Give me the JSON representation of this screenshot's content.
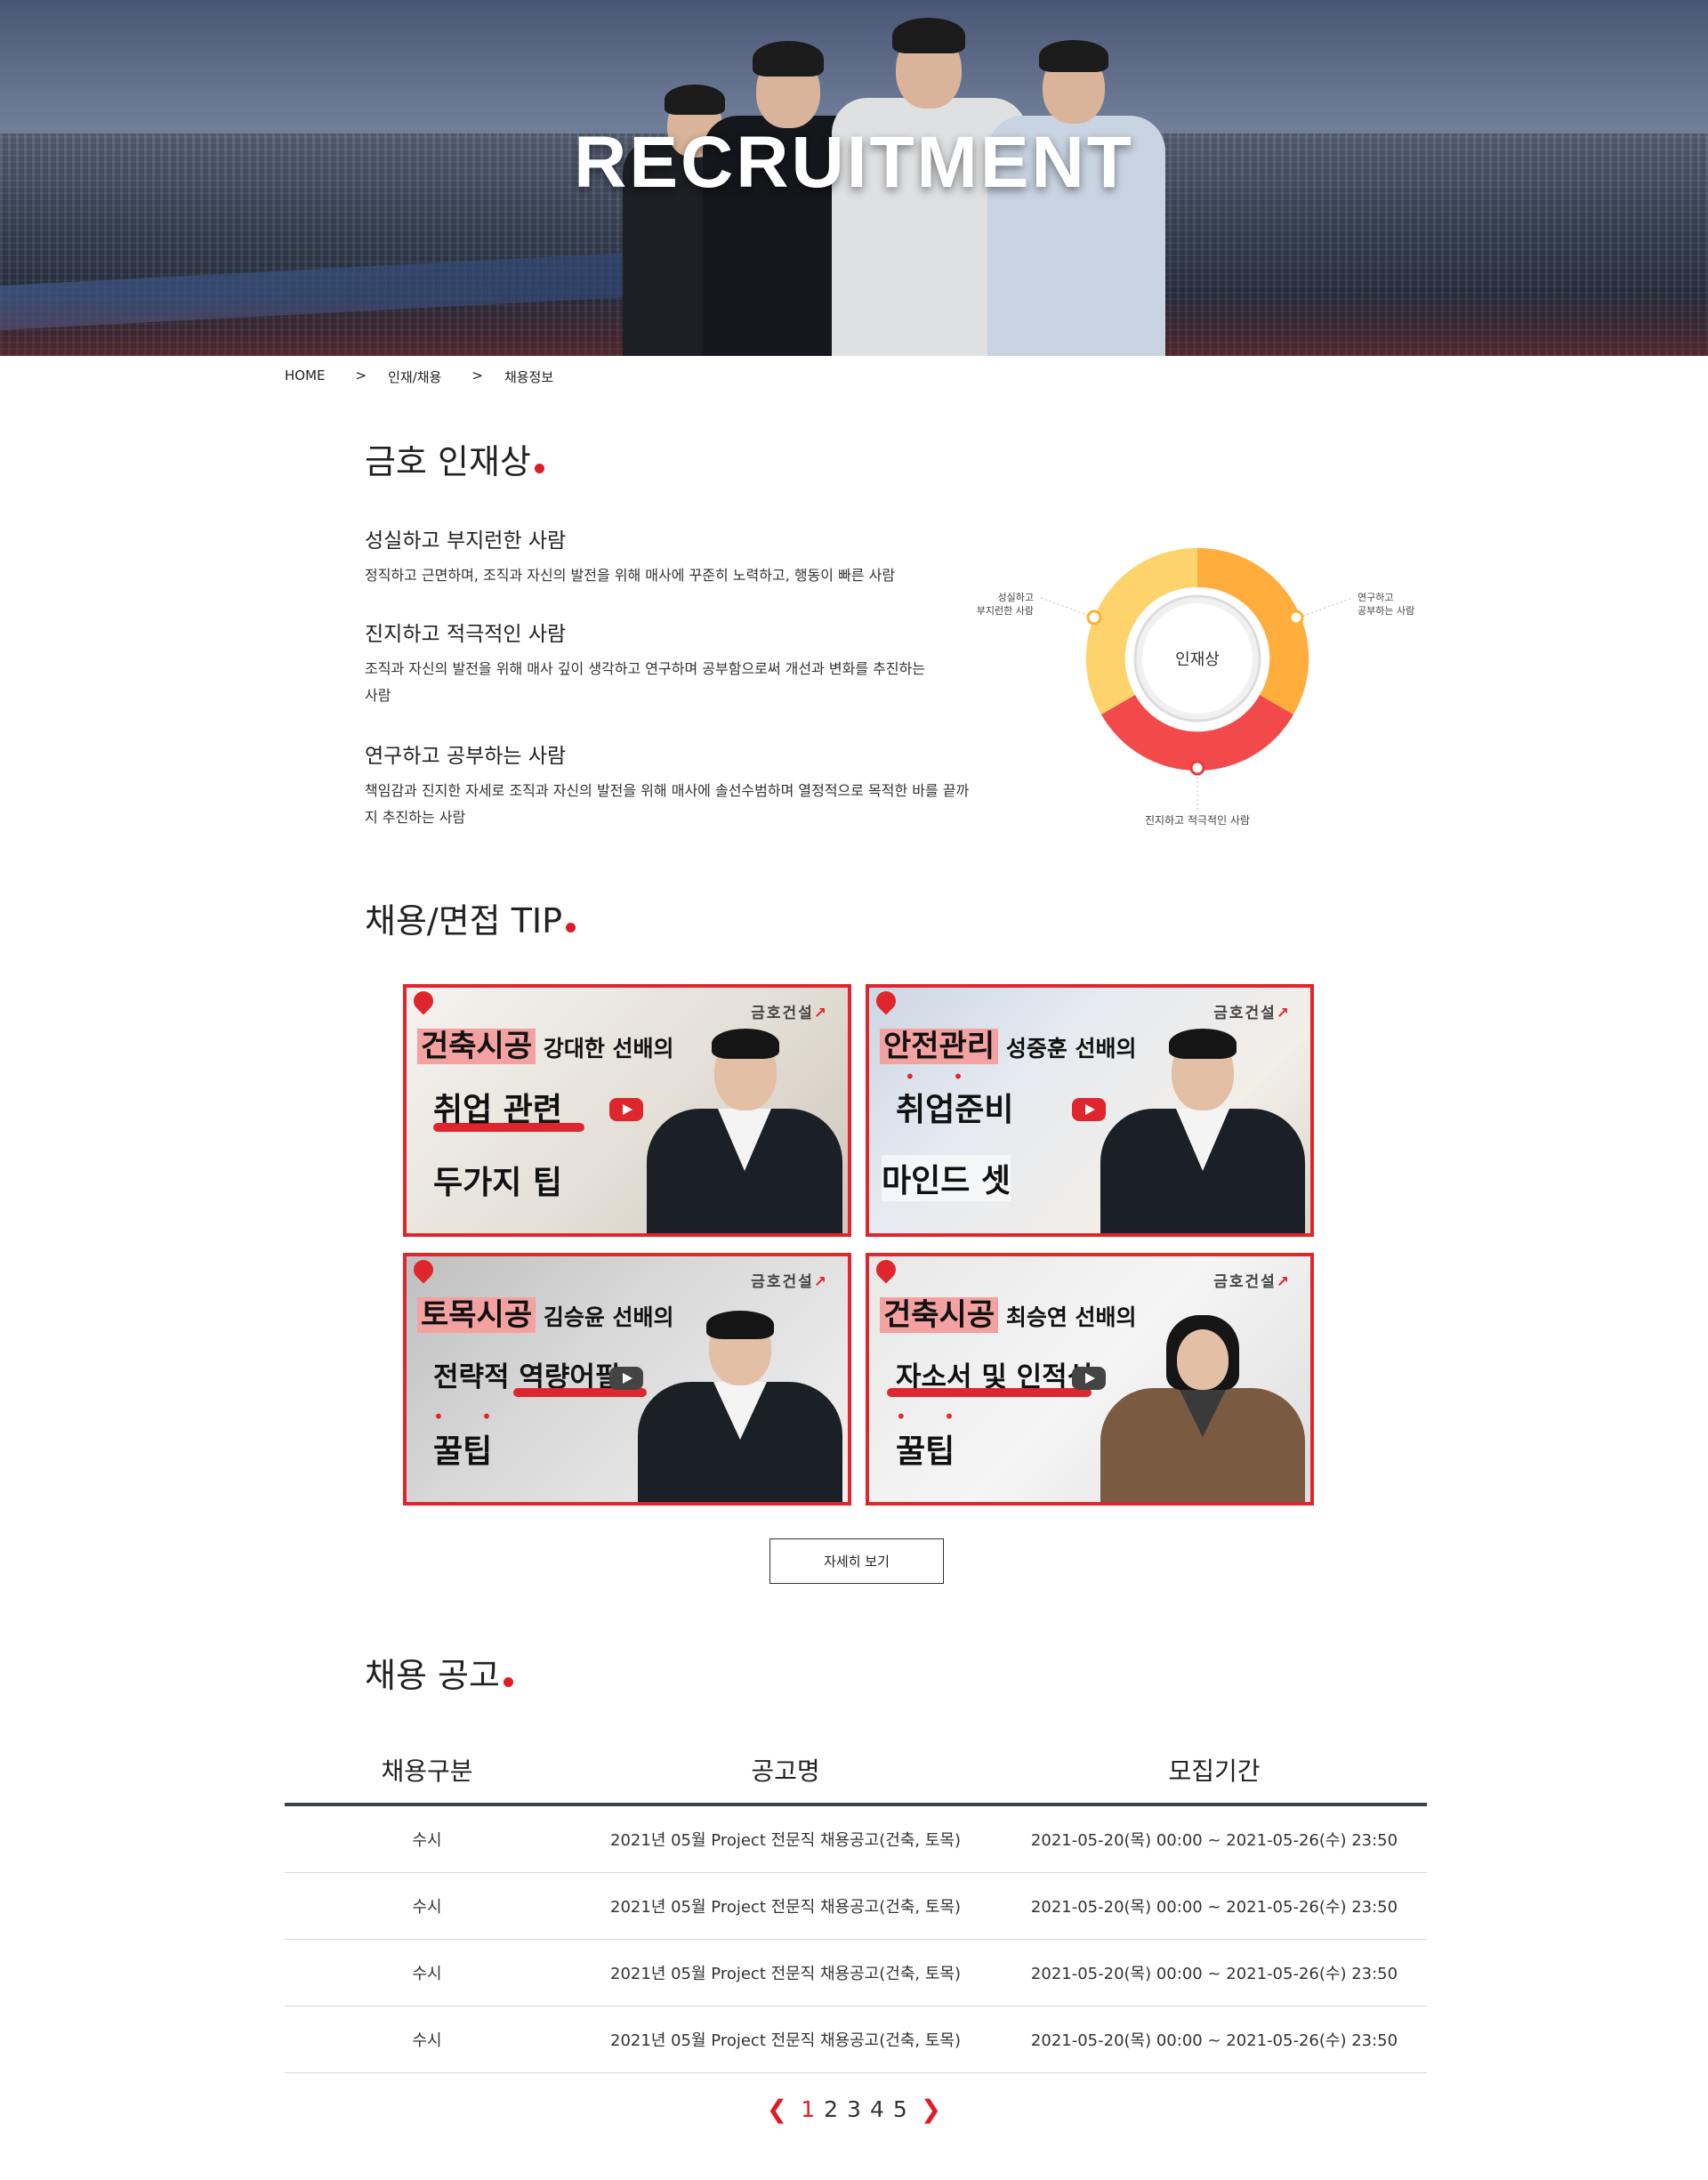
{
  "hero": {
    "title": "RECRUITMENT"
  },
  "breadcrumb": {
    "home": "HOME",
    "sep": ">",
    "level1": "인재/채용",
    "level2": "채용정보"
  },
  "talent": {
    "title": "금호 인재상",
    "items": [
      {
        "heading": "성실하고 부지런한 사람",
        "desc": "정직하고 근면하며, 조직과 자신의 발전을 위해 매사에 꾸준히 노력하고, 행동이 빠른 사람"
      },
      {
        "heading": "진지하고 적극적인 사람",
        "desc": "조직과 자신의 발전을 위해 매사 깊이 생각하고 연구하며 공부함으로써 개선과 변화를 추진하는 사람"
      },
      {
        "heading": "연구하고 공부하는 사람",
        "desc": "책임감과 진지한 자세로 조직과 자신의 발전을 위해 매사에 솔선수범하며 열정적으로 목적한 바를 끝까지 추진하는 사람"
      }
    ],
    "diagram": {
      "center": "인재상",
      "left_label_1": "성실하고",
      "left_label_2": "부지런한 사람",
      "right_label_1": "연구하고",
      "right_label_2": "공부하는 사람",
      "bottom_label": "진지하고 적극적인 사람",
      "colors": {
        "left": "#ffd36b",
        "right": "#ffad3d",
        "bottom": "#f24a4a"
      }
    }
  },
  "tips": {
    "title": "채용/면접 TIP",
    "brand": "금호건설",
    "cards": [
      {
        "line1_hl": "건축시공",
        "line1_rest": " 강대한 선배의",
        "line2": "취업 관련",
        "line3": "두가지 팁"
      },
      {
        "line1_hl": "안전관리",
        "line1_rest": " 성중훈 선배의",
        "line2": "취업준비",
        "line3": "마인드 셋"
      },
      {
        "line1_hl": "토목시공",
        "line1_rest": " 김승윤 선배의",
        "line2": "전략적 역량어필",
        "line3": "꿀팁"
      },
      {
        "line1_hl": "건축시공",
        "line1_rest": " 최승연 선배의",
        "line2": "자소서 및 인적성",
        "line3": "꿀팁"
      }
    ],
    "more_label": "자세히 보기"
  },
  "jobs": {
    "title": "채용 공고",
    "headers": [
      "채용구분",
      "공고명",
      "모집기간"
    ],
    "rows": [
      {
        "type": "수시",
        "name": "2021년 05월 Project 전문직 채용공고(건축, 토목)",
        "period": "2021-05-20(목) 00:00 ~ 2021-05-26(수) 23:50"
      },
      {
        "type": "수시",
        "name": "2021년 05월 Project 전문직 채용공고(건축, 토목)",
        "period": "2021-05-20(목) 00:00 ~ 2021-05-26(수) 23:50"
      },
      {
        "type": "수시",
        "name": "2021년 05월 Project 전문직 채용공고(건축, 토목)",
        "period": "2021-05-20(목) 00:00 ~ 2021-05-26(수) 23:50"
      },
      {
        "type": "수시",
        "name": "2021년 05월 Project 전문직 채용공고(건축, 토목)",
        "period": "2021-05-20(목) 00:00 ~ 2021-05-26(수) 23:50"
      }
    ]
  },
  "pager": {
    "prev_icon": "chevron-left-icon",
    "next_icon": "chevron-right-icon",
    "pages": [
      "1",
      "2",
      "3",
      "4",
      "5"
    ],
    "current": "1"
  },
  "colors": {
    "accent": "#e01b24",
    "card_border": "#e0262d"
  }
}
